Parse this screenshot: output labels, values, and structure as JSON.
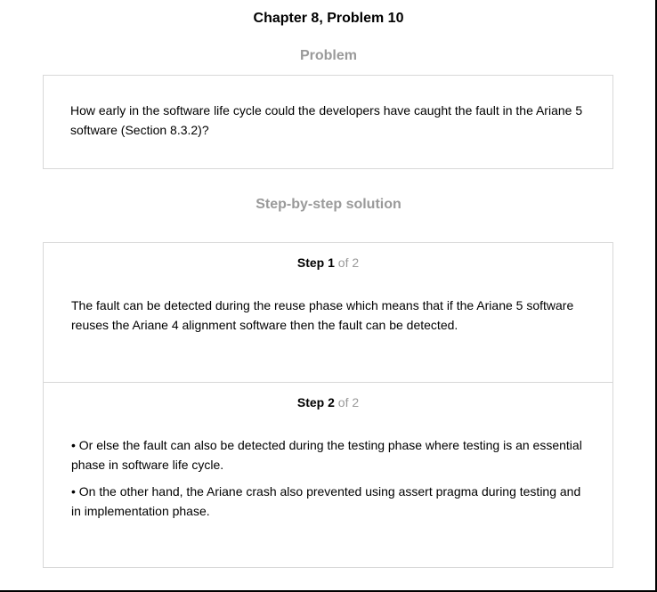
{
  "page": {
    "chapter_title": "Chapter 8, Problem 10"
  },
  "problem": {
    "heading": "Problem",
    "text": "How early in the software life cycle could the developers have caught the fault in the Ariane 5 software (Section 8.3.2)?"
  },
  "solution": {
    "heading": "Step-by-step solution",
    "steps": [
      {
        "word": "Step",
        "number": "1",
        "of_text": "of 2",
        "paragraphs": [
          "The fault can be detected during the reuse phase which means that if the Ariane 5 software reuses the Ariane 4 alignment software then the fault can be detected."
        ]
      },
      {
        "word": "Step",
        "number": "2",
        "of_text": "of 2",
        "paragraphs": [
          "• Or else the fault can also be detected during the testing phase where testing is an essential phase in software life cycle.",
          "• On the other hand, the Ariane crash also prevented using assert pragma during testing and in implementation phase."
        ]
      }
    ]
  },
  "colors": {
    "heading_gray": "#9a9a9a",
    "border": "#d8d8d8",
    "frame": "#000000"
  }
}
